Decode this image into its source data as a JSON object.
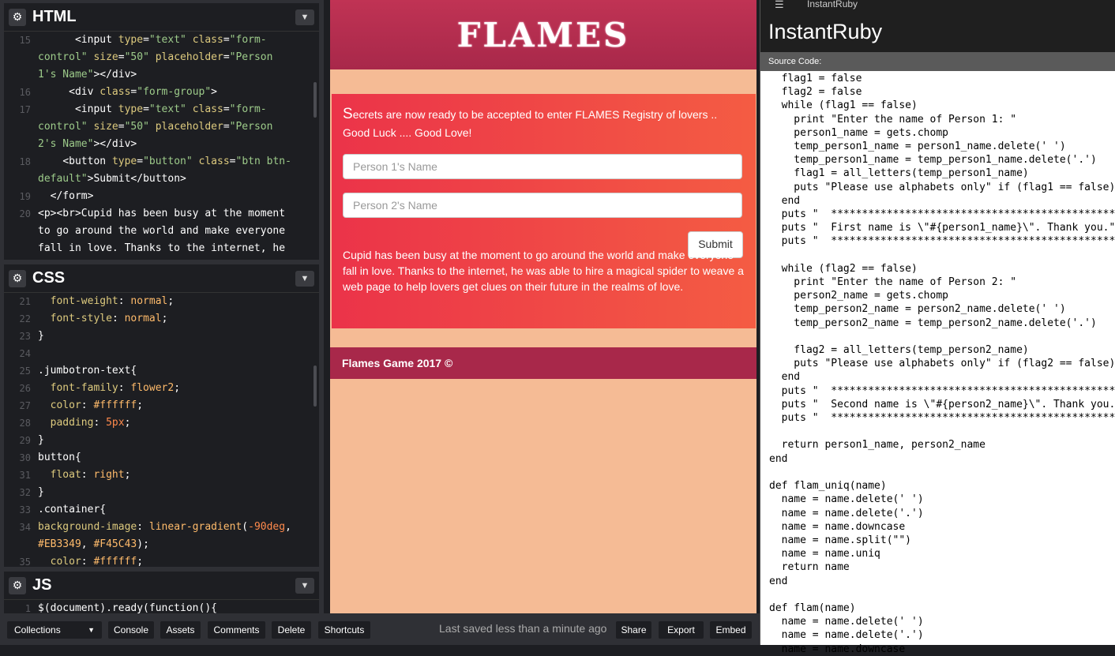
{
  "editor": {
    "html": {
      "title": "HTML",
      "lines": [
        {
          "n": "15",
          "segments": [
            [
              "",
              "      "
            ],
            [
              "t-tag",
              "<input "
            ],
            [
              "t-attr",
              "type"
            ],
            [
              "t-tag",
              "="
            ],
            [
              "t-str",
              "\"text\""
            ],
            [
              "t-tag",
              " "
            ],
            [
              "t-attr",
              "class"
            ],
            [
              "t-tag",
              "="
            ],
            [
              "t-str",
              "\"form-"
            ]
          ]
        },
        {
          "n": "",
          "segments": [
            [
              "t-str",
              "control\""
            ],
            [
              "t-tag",
              " "
            ],
            [
              "t-attr",
              "size"
            ],
            [
              "t-tag",
              "="
            ],
            [
              "t-str",
              "\"50\""
            ],
            [
              "t-tag",
              " "
            ],
            [
              "t-attr",
              "placeholder"
            ],
            [
              "t-tag",
              "="
            ],
            [
              "t-str",
              "\"Person"
            ]
          ]
        },
        {
          "n": "",
          "segments": [
            [
              "t-str",
              "1's Name\""
            ],
            [
              "t-tag",
              "></div>"
            ]
          ]
        },
        {
          "n": "16",
          "segments": [
            [
              "",
              "     "
            ],
            [
              "t-tag",
              "<div "
            ],
            [
              "t-attr",
              "class"
            ],
            [
              "t-tag",
              "="
            ],
            [
              "t-str",
              "\"form-group\""
            ],
            [
              "t-tag",
              ">"
            ]
          ]
        },
        {
          "n": "17",
          "segments": [
            [
              "",
              "      "
            ],
            [
              "t-tag",
              "<input "
            ],
            [
              "t-attr",
              "type"
            ],
            [
              "t-tag",
              "="
            ],
            [
              "t-str",
              "\"text\""
            ],
            [
              "t-tag",
              " "
            ],
            [
              "t-attr",
              "class"
            ],
            [
              "t-tag",
              "="
            ],
            [
              "t-str",
              "\"form-"
            ]
          ]
        },
        {
          "n": "",
          "segments": [
            [
              "t-str",
              "control\""
            ],
            [
              "t-tag",
              " "
            ],
            [
              "t-attr",
              "size"
            ],
            [
              "t-tag",
              "="
            ],
            [
              "t-str",
              "\"50\""
            ],
            [
              "t-tag",
              " "
            ],
            [
              "t-attr",
              "placeholder"
            ],
            [
              "t-tag",
              "="
            ],
            [
              "t-str",
              "\"Person"
            ]
          ]
        },
        {
          "n": "",
          "segments": [
            [
              "t-str",
              "2's Name\""
            ],
            [
              "t-tag",
              "></div>"
            ]
          ]
        },
        {
          "n": "18",
          "segments": [
            [
              "",
              "    "
            ],
            [
              "t-tag",
              "<button "
            ],
            [
              "t-attr",
              "type"
            ],
            [
              "t-tag",
              "="
            ],
            [
              "t-str",
              "\"button\""
            ],
            [
              "t-tag",
              " "
            ],
            [
              "t-attr",
              "class"
            ],
            [
              "t-tag",
              "="
            ],
            [
              "t-str",
              "\"btn btn-"
            ]
          ]
        },
        {
          "n": "",
          "segments": [
            [
              "t-str",
              "default\""
            ],
            [
              "t-tag",
              ">"
            ],
            [
              "",
              "Submit"
            ],
            [
              "t-tag",
              "</button>"
            ]
          ]
        },
        {
          "n": "19",
          "segments": [
            [
              "",
              "  "
            ],
            [
              "t-tag",
              "</form>"
            ]
          ]
        },
        {
          "n": "20",
          "segments": [
            [
              "t-tag",
              "<p><br>"
            ],
            [
              "",
              "Cupid has been busy at the moment"
            ]
          ]
        },
        {
          "n": "",
          "segments": [
            [
              "",
              "to go around the world and make everyone"
            ]
          ]
        },
        {
          "n": "",
          "segments": [
            [
              "",
              "fall in love. Thanks to the internet, he"
            ]
          ]
        }
      ]
    },
    "css": {
      "title": "CSS",
      "lines": [
        {
          "n": "21",
          "segments": [
            [
              "",
              "  "
            ],
            [
              "t-prop",
              "font-weight"
            ],
            [
              "",
              ": "
            ],
            [
              "t-val",
              "normal"
            ],
            [
              "",
              ";"
            ]
          ]
        },
        {
          "n": "22",
          "segments": [
            [
              "",
              "  "
            ],
            [
              "t-prop",
              "font-style"
            ],
            [
              "",
              ": "
            ],
            [
              "t-val",
              "normal"
            ],
            [
              "",
              ";"
            ]
          ]
        },
        {
          "n": "23",
          "segments": [
            [
              "",
              "}"
            ]
          ]
        },
        {
          "n": "24",
          "segments": [
            [
              "",
              ""
            ]
          ]
        },
        {
          "n": "25",
          "segments": [
            [
              "t-sel",
              ".jumbotron-text{"
            ]
          ]
        },
        {
          "n": "26",
          "segments": [
            [
              "",
              "  "
            ],
            [
              "t-prop",
              "font-family"
            ],
            [
              "",
              ": "
            ],
            [
              "t-val",
              "flower2"
            ],
            [
              "",
              ";"
            ]
          ]
        },
        {
          "n": "27",
          "segments": [
            [
              "",
              "  "
            ],
            [
              "t-prop",
              "color"
            ],
            [
              "",
              ": "
            ],
            [
              "t-val",
              "#ffffff"
            ],
            [
              "",
              ";"
            ]
          ]
        },
        {
          "n": "28",
          "segments": [
            [
              "",
              "  "
            ],
            [
              "t-prop",
              "padding"
            ],
            [
              "",
              ": "
            ],
            [
              "t-num",
              "5px"
            ],
            [
              "",
              ";"
            ]
          ]
        },
        {
          "n": "29",
          "segments": [
            [
              "",
              "}"
            ]
          ]
        },
        {
          "n": "30",
          "segments": [
            [
              "t-sel",
              "button{"
            ]
          ]
        },
        {
          "n": "31",
          "segments": [
            [
              "",
              "  "
            ],
            [
              "t-prop",
              "float"
            ],
            [
              "",
              ": "
            ],
            [
              "t-val",
              "right"
            ],
            [
              "",
              ";"
            ]
          ]
        },
        {
          "n": "32",
          "segments": [
            [
              "",
              "}"
            ]
          ]
        },
        {
          "n": "33",
          "segments": [
            [
              "t-sel",
              ".container{"
            ]
          ]
        },
        {
          "n": "34",
          "segments": [
            [
              "t-prop",
              "background-image"
            ],
            [
              "",
              ": "
            ],
            [
              "t-val",
              "linear-gradient"
            ],
            [
              "",
              "("
            ],
            [
              "t-num",
              "-90deg"
            ],
            [
              "",
              ","
            ]
          ]
        },
        {
          "n": "",
          "segments": [
            [
              "t-val",
              "#EB3349"
            ],
            [
              "",
              ", "
            ],
            [
              "t-val",
              "#F45C43"
            ],
            [
              "",
              ");"
            ]
          ]
        },
        {
          "n": "35",
          "segments": [
            [
              "",
              "  "
            ],
            [
              "t-prop",
              "color"
            ],
            [
              "",
              ": "
            ],
            [
              "t-val",
              "#ffffff"
            ],
            [
              "",
              ";"
            ]
          ]
        }
      ]
    },
    "js": {
      "title": "JS",
      "lines": [
        {
          "n": "1",
          "segments": [
            [
              "",
              "$(document).ready(function(){"
            ]
          ]
        }
      ]
    }
  },
  "preview": {
    "logo": "FLAMES",
    "intro_big": "S",
    "intro_rest": "ecrets are now ready to be accepted to enter FLAMES Registry of lovers .. Good Luck .... Good Love!",
    "input1_placeholder": "Person 1's Name",
    "input2_placeholder": "Person 2's Name",
    "submit_label": "Submit",
    "paragraph": "Cupid has been busy at the moment to go around the world and make everyone fall in love. Thanks to the internet, he was able to hire a magical spider to weave a web page to help lovers get clues on their future in the realms of love.",
    "footer": "Flames Game 2017 ©"
  },
  "instantruby": {
    "window_title": "InstantRuby",
    "header": "InstantRuby",
    "sub_label": "Source Code:",
    "code": "  flag1 = false\n  flag2 = false\n  while (flag1 == false)\n    print \"Enter the name of Person 1: \"\n    person1_name = gets.chomp\n    temp_person1_name = person1_name.delete(' ')\n    temp_person1_name = temp_person1_name.delete('.')\n    flag1 = all_letters(temp_person1_name)\n    puts \"Please use alphabets only\" if (flag1 == false)\n  end\n  puts \"  ************************************************\"\n  puts \"  First name is \\\"#{person1_name}\\\". Thank you.\"\n  puts \"  ************************************************\"\n\n  while (flag2 == false)\n    print \"Enter the name of Person 2: \"\n    person2_name = gets.chomp\n    temp_person2_name = person2_name.delete(' ')\n    temp_person2_name = temp_person2_name.delete('.')\n\n    flag2 = all_letters(temp_person2_name)\n    puts \"Please use alphabets only\" if (flag2 == false)\n  end\n  puts \"  ************************************************\"\n  puts \"  Second name is \\\"#{person2_name}\\\". Thank you.\"\n  puts \"  ************************************************\"\n\n  return person1_name, person2_name\nend\n\ndef flam_uniq(name)\n  name = name.delete(' ')\n  name = name.delete('.')\n  name = name.downcase\n  name = name.split(\"\")\n  name = name.uniq\n  return name\nend\n\ndef flam(name)\n  name = name.delete(' ')\n  name = name.delete('.')\n  name = name.downcase"
  },
  "bottombar": {
    "collections": "Collections",
    "console": "Console",
    "assets": "Assets",
    "comments": "Comments",
    "delete": "Delete",
    "shortcuts": "Shortcuts",
    "status": "Last saved less than a minute ago",
    "share": "Share",
    "export": "Export",
    "embed": "Embed"
  },
  "icons": {
    "gear": "gear-icon",
    "chevron": "chevron-down-icon",
    "menu": "hamburger-menu-icon"
  },
  "colors": {
    "gradient_start": "#EB3349",
    "gradient_end": "#F45C43",
    "preview_bg": "#f5bb95",
    "header_bg": "#a8284a"
  }
}
